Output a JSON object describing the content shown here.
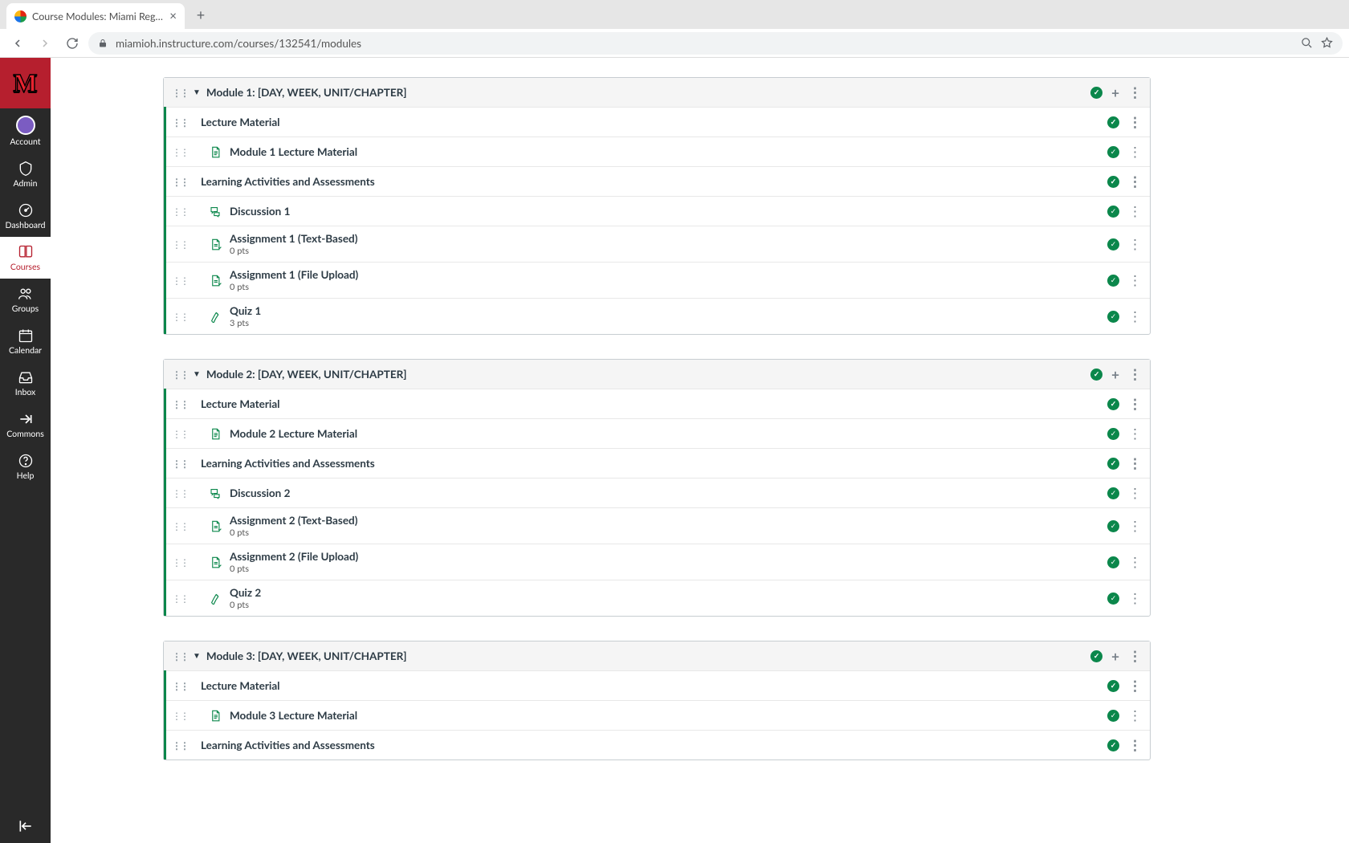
{
  "browser": {
    "tab_title": "Course Modules: Miami Region…",
    "url": "miamioh.instructure.com/courses/132541/modules"
  },
  "global_nav": [
    {
      "icon": "avatar",
      "label": "Account"
    },
    {
      "icon": "admin",
      "label": "Admin"
    },
    {
      "icon": "dashboard",
      "label": "Dashboard"
    },
    {
      "icon": "courses",
      "label": "Courses",
      "active": true
    },
    {
      "icon": "groups",
      "label": "Groups"
    },
    {
      "icon": "calendar",
      "label": "Calendar"
    },
    {
      "icon": "inbox",
      "label": "Inbox"
    },
    {
      "icon": "commons",
      "label": "Commons"
    },
    {
      "icon": "help",
      "label": "Help"
    }
  ],
  "modules": [
    {
      "title": "Module 1: [DAY, WEEK, UNIT/CHAPTER]",
      "items": [
        {
          "type": "subheader",
          "title": "Lecture Material"
        },
        {
          "type": "page",
          "title": "Module 1 Lecture Material"
        },
        {
          "type": "subheader",
          "title": "Learning Activities and Assessments"
        },
        {
          "type": "discussion",
          "title": "Discussion 1"
        },
        {
          "type": "assignment",
          "title": "Assignment 1 (Text-Based)",
          "meta": "0 pts"
        },
        {
          "type": "assignment",
          "title": "Assignment 1 (File Upload)",
          "meta": "0 pts"
        },
        {
          "type": "quiz",
          "title": "Quiz 1",
          "meta": "3 pts"
        }
      ]
    },
    {
      "title": "Module 2: [DAY, WEEK, UNIT/CHAPTER]",
      "items": [
        {
          "type": "subheader",
          "title": "Lecture Material"
        },
        {
          "type": "page",
          "title": "Module 2 Lecture Material"
        },
        {
          "type": "subheader",
          "title": "Learning Activities and Assessments"
        },
        {
          "type": "discussion",
          "title": "Discussion 2"
        },
        {
          "type": "assignment",
          "title": "Assignment 2 (Text-Based)",
          "meta": "0 pts"
        },
        {
          "type": "assignment",
          "title": "Assignment 2 (File Upload)",
          "meta": "0 pts"
        },
        {
          "type": "quiz",
          "title": "Quiz 2",
          "meta": "0 pts"
        }
      ]
    },
    {
      "title": "Module 3: [DAY, WEEK, UNIT/CHAPTER]",
      "items": [
        {
          "type": "subheader",
          "title": "Lecture Material"
        },
        {
          "type": "page",
          "title": "Module 3 Lecture Material"
        },
        {
          "type": "subheader",
          "title": "Learning Activities and Assessments"
        }
      ]
    }
  ]
}
